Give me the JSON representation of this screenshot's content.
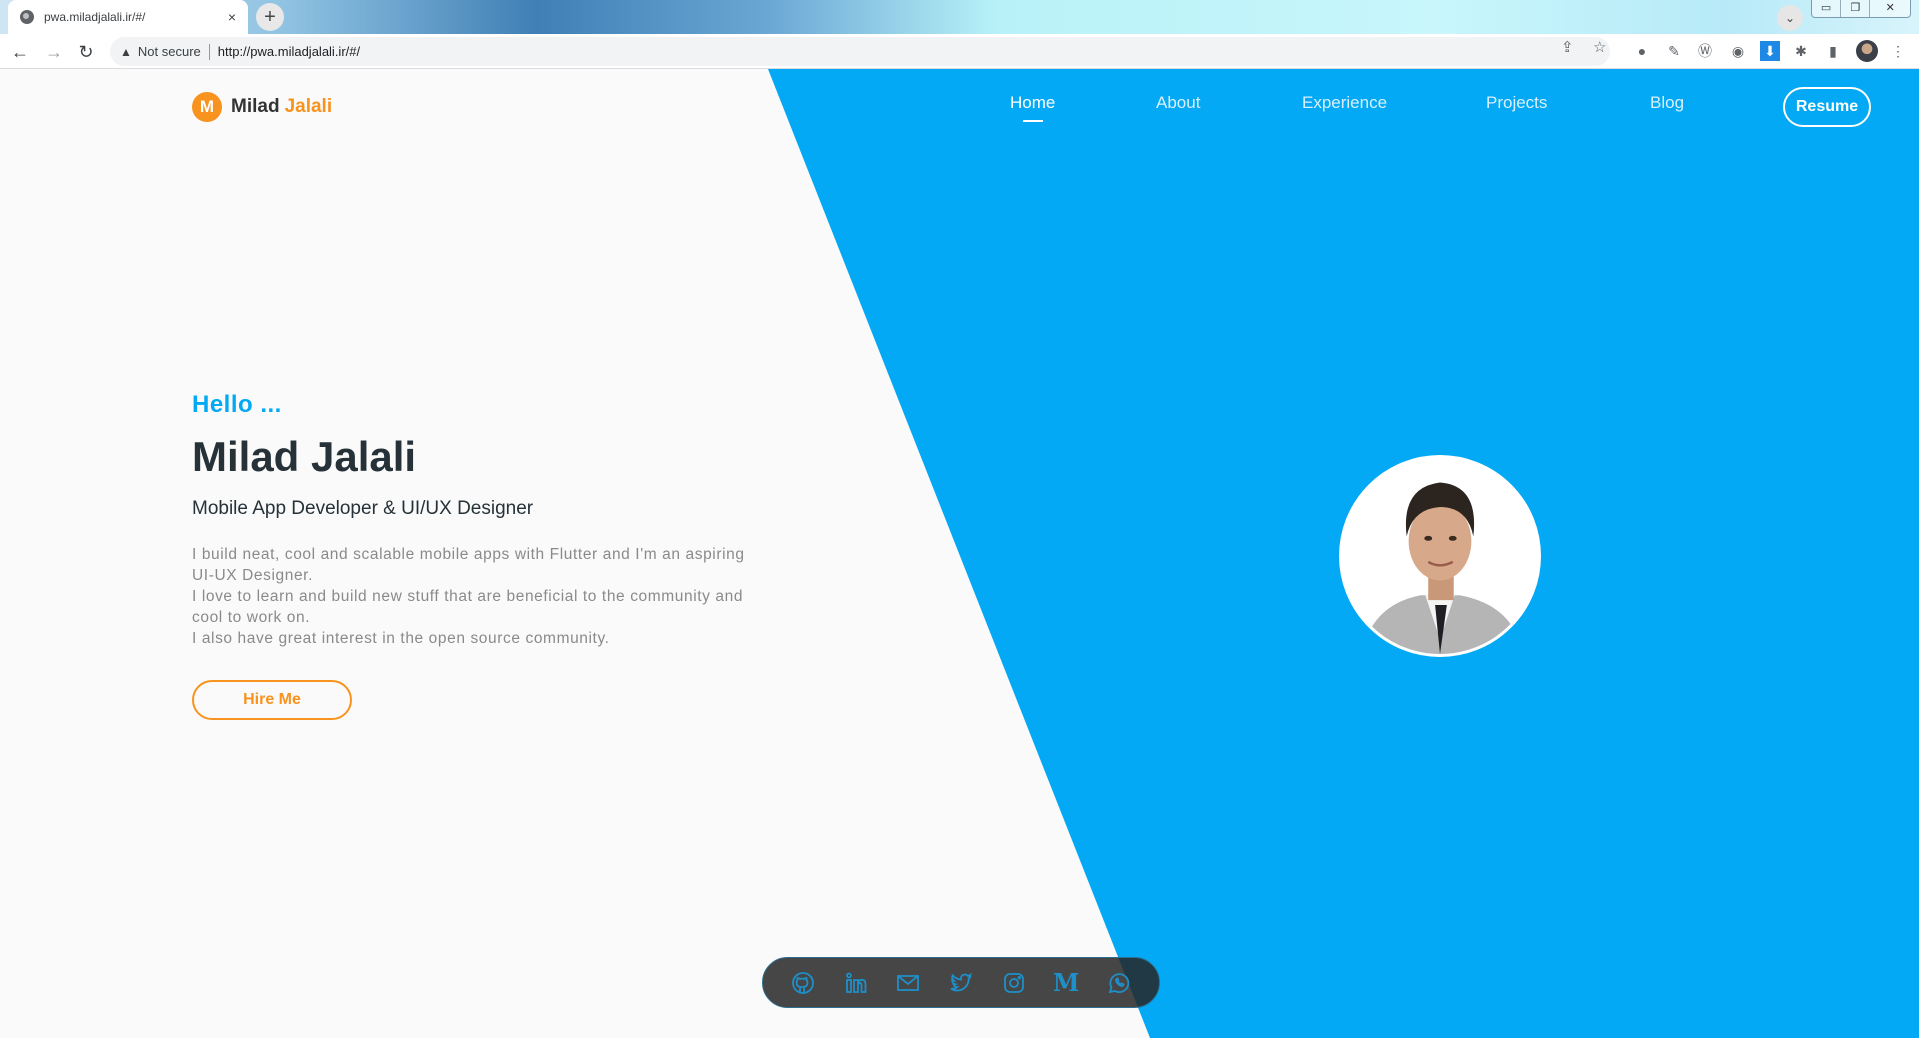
{
  "browser": {
    "tab_title": "pwa.miladjalali.ir/#/",
    "tab_close": "×",
    "new_tab": "+",
    "tab_search": "⌄",
    "window_controls": [
      "▭",
      "❐",
      "✕"
    ],
    "back": "←",
    "forward": "→",
    "reload": "↻",
    "security_icon": "▲",
    "security_label": "Not secure",
    "url": "http://pwa.miladjalali.ir/#/",
    "share": "⇪",
    "bookmark": "☆",
    "extensions": [
      "●",
      "✎",
      "Ⓦ",
      "◉",
      "⬇",
      "✱",
      "▮"
    ],
    "menu": "⋮"
  },
  "site": {
    "logo": {
      "mark": "M",
      "first": "Milad",
      "last": "Jalali"
    },
    "nav": [
      {
        "label": "Home",
        "active": true
      },
      {
        "label": "About",
        "active": false
      },
      {
        "label": "Experience",
        "active": false
      },
      {
        "label": "Projects",
        "active": false
      },
      {
        "label": "Blog",
        "active": false
      }
    ],
    "resume_label": "Resume",
    "hero": {
      "greeting": "Hello ...",
      "name": "Milad Jalali",
      "subtitle": "Mobile App Developer & UI/UX Designer",
      "bio": [
        "I build neat, cool and scalable mobile apps with Flutter and I'm an aspiring UI-UX Designer.",
        "I love to learn and build new stuff that are beneficial to the community and cool to work on.",
        "I also have great interest in the open source community."
      ],
      "hire_label": "Hire Me"
    },
    "social": [
      "github-icon",
      "linkedin-icon",
      "mail-icon",
      "twitter-icon",
      "instagram-icon",
      "medium-icon",
      "whatsapp-icon"
    ],
    "medium_glyph": "M",
    "colors": {
      "primary": "#03a9f4",
      "accent": "#f7931e",
      "text": "#263238",
      "muted": "#8a8a8a"
    }
  }
}
